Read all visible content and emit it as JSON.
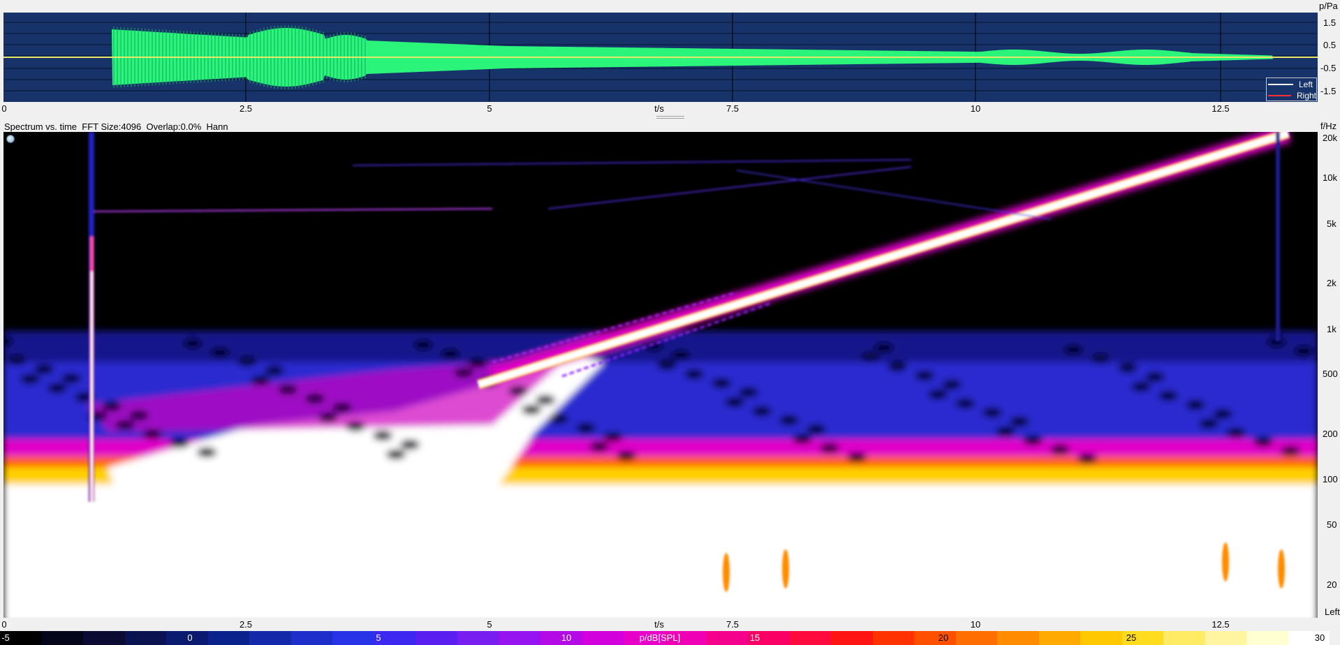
{
  "waveform": {
    "y_unit_label": "p/Pa",
    "y_ticks": [
      "1.5",
      "0.5",
      "-0.5",
      "-1.5"
    ],
    "x_unit_label": "t/s",
    "x_ticks": [
      "0",
      "2.5",
      "5",
      "7.5",
      "10",
      "12.5"
    ],
    "legend": [
      {
        "label": "Left",
        "color": "#ffffff"
      },
      {
        "label": "Right",
        "color": "#ff3030"
      }
    ],
    "colors": {
      "background": "#17336a",
      "signal": "#2af57a",
      "centerline": "#e9e66a",
      "grid": "#000000"
    }
  },
  "spectrogram": {
    "header": "Spectrum vs. time  FFT Size:4096  Overlap:0.0%  Hann",
    "title": "Spectrum vs. time",
    "fft_size": "FFT Size:4096",
    "overlap": "Overlap:0.0%",
    "window": "Hann",
    "y_unit_label": "f/Hz",
    "y_ticks": [
      "20k",
      "10k",
      "5k",
      "2k",
      "1k",
      "500",
      "200",
      "100",
      "50",
      "20"
    ],
    "x_unit_label": "t/s",
    "x_ticks": [
      "0",
      "2.5",
      "5",
      "7.5",
      "10",
      "12.5"
    ],
    "channel_label": "Left",
    "settings_icon": "circle-button-icon"
  },
  "colorbar": {
    "unit_label": "p/dB[SPL]",
    "ticks": [
      "-5",
      "0",
      "5",
      "10",
      "15",
      "20",
      "25",
      "30"
    ],
    "colors": [
      "#000000",
      "#050519",
      "#0a0a33",
      "#0a1250",
      "#0a1a6e",
      "#0a228c",
      "#1428aa",
      "#1e2ec8",
      "#2832e6",
      "#3c28f0",
      "#5a1ef0",
      "#781ef0",
      "#9614f0",
      "#b40ae6",
      "#d200dc",
      "#e600c8",
      "#f000b4",
      "#f5008c",
      "#fa0064",
      "#ff0a3c",
      "#ff1414",
      "#ff3200",
      "#ff5000",
      "#ff6e00",
      "#ff8c00",
      "#ffaa00",
      "#ffc800",
      "#ffdc1e",
      "#ffeb64",
      "#fff5a0",
      "#ffffd2",
      "#ffffff"
    ]
  }
}
